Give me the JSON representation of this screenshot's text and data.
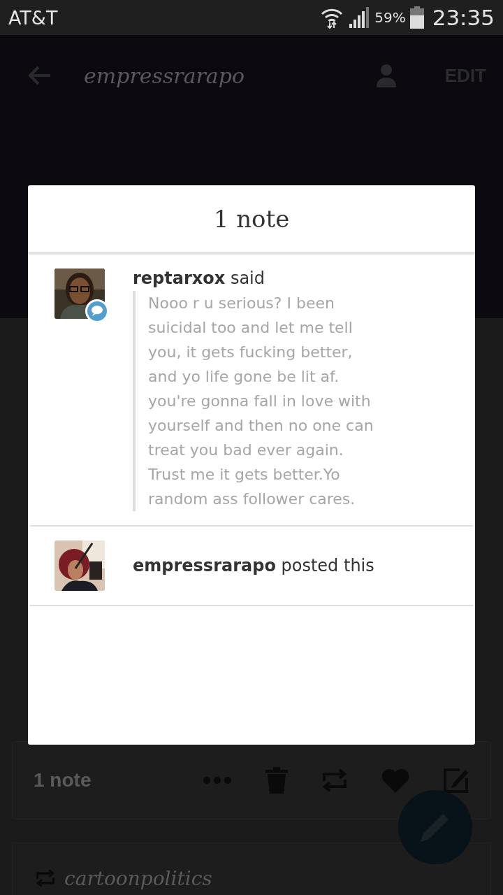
{
  "status_bar": {
    "carrier": "AT&T",
    "battery": "59%",
    "time": "23:35"
  },
  "header": {
    "title": "empressrarapo",
    "edit": "EDIT"
  },
  "post_footer": {
    "notes": "1 note"
  },
  "reblog_row": {
    "blog": "cartoonpolitics"
  },
  "dialog": {
    "title": "1 note",
    "notes": [
      {
        "kind": "reply",
        "user": "reptarxox",
        "action": "said",
        "text": "Nooo r u serious? I been suicidal too and let me tell you, it gets fucking better, and yo life gone be lit af. you're gonna fall in love with yourself and then no one can treat you bad ever again. Trust me it gets better.Yo random ass follower cares."
      },
      {
        "kind": "post",
        "user": "empressrarapo",
        "action": "posted this"
      }
    ]
  }
}
